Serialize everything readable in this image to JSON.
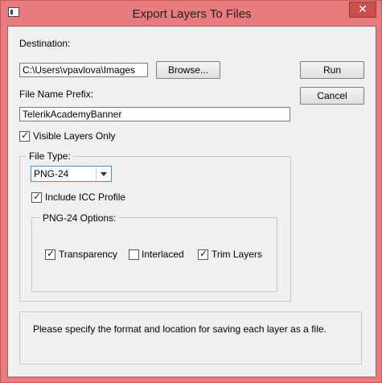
{
  "window": {
    "title": "Export Layers To Files",
    "close_label": "✕"
  },
  "destination": {
    "label": "Destination:",
    "value": "C:\\Users\\vpavlova\\Images",
    "browse_label": "Browse..."
  },
  "prefix": {
    "label": "File Name Prefix:",
    "value": "TelerikAcademyBanner"
  },
  "visible_only": {
    "label": "Visible Layers Only",
    "checked": true
  },
  "actions": {
    "run_label": "Run",
    "cancel_label": "Cancel"
  },
  "file_type": {
    "legend": "File Type:",
    "selected": "PNG-24",
    "icc": {
      "label": "Include ICC Profile",
      "checked": true
    },
    "options_group": {
      "legend": "PNG-24 Options:",
      "transparency": {
        "label": "Transparency",
        "checked": true
      },
      "interlaced": {
        "label": "Interlaced",
        "checked": false
      },
      "trim": {
        "label": "Trim Layers",
        "checked": true
      }
    }
  },
  "status_text": "Please specify the format and location for saving each layer as a file.",
  "check_glyph": "✓"
}
